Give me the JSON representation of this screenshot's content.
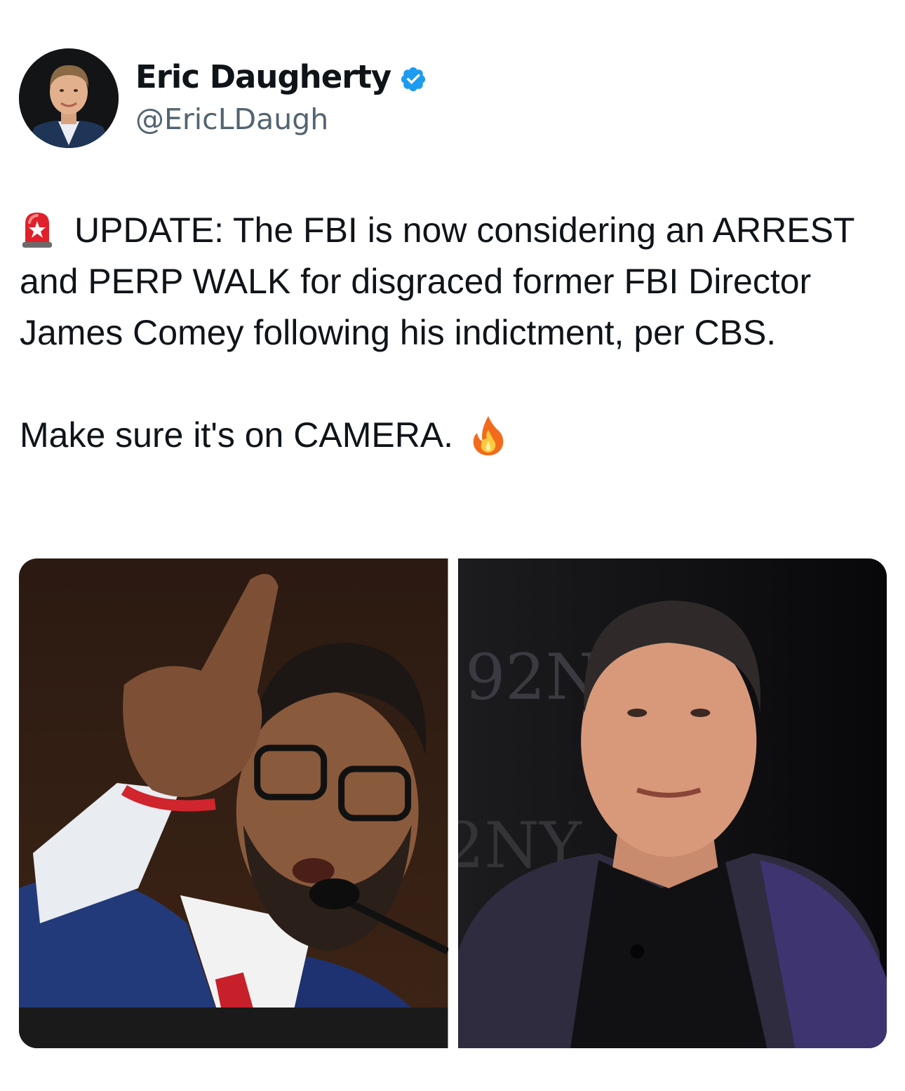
{
  "author": {
    "display_name": "Eric Daugherty",
    "handle": "@EricLDaugh",
    "verified": true,
    "avatar_icon": "profile-photo"
  },
  "tweet": {
    "paragraphs": [
      {
        "leading_emoji": "police-light-icon",
        "text": "UPDATE: The FBI is now considering an ARREST and PERP WALK for disgraced former FBI Director James Comey following his indictment, per CBS."
      },
      {
        "text": "Make sure it's on CAMERA.",
        "trailing_emoji": "fire-icon"
      }
    ]
  },
  "media": [
    {
      "kind": "photo",
      "icon": "photo-man-pointing-at-microphone"
    },
    {
      "kind": "photo",
      "icon": "photo-man-in-dark-blazer",
      "backdrop_text": "92NY"
    }
  ],
  "colors": {
    "text": "#0f1419",
    "secondary_text": "#536471",
    "verified_blue": "#1d9bf0",
    "background": "#ffffff"
  }
}
